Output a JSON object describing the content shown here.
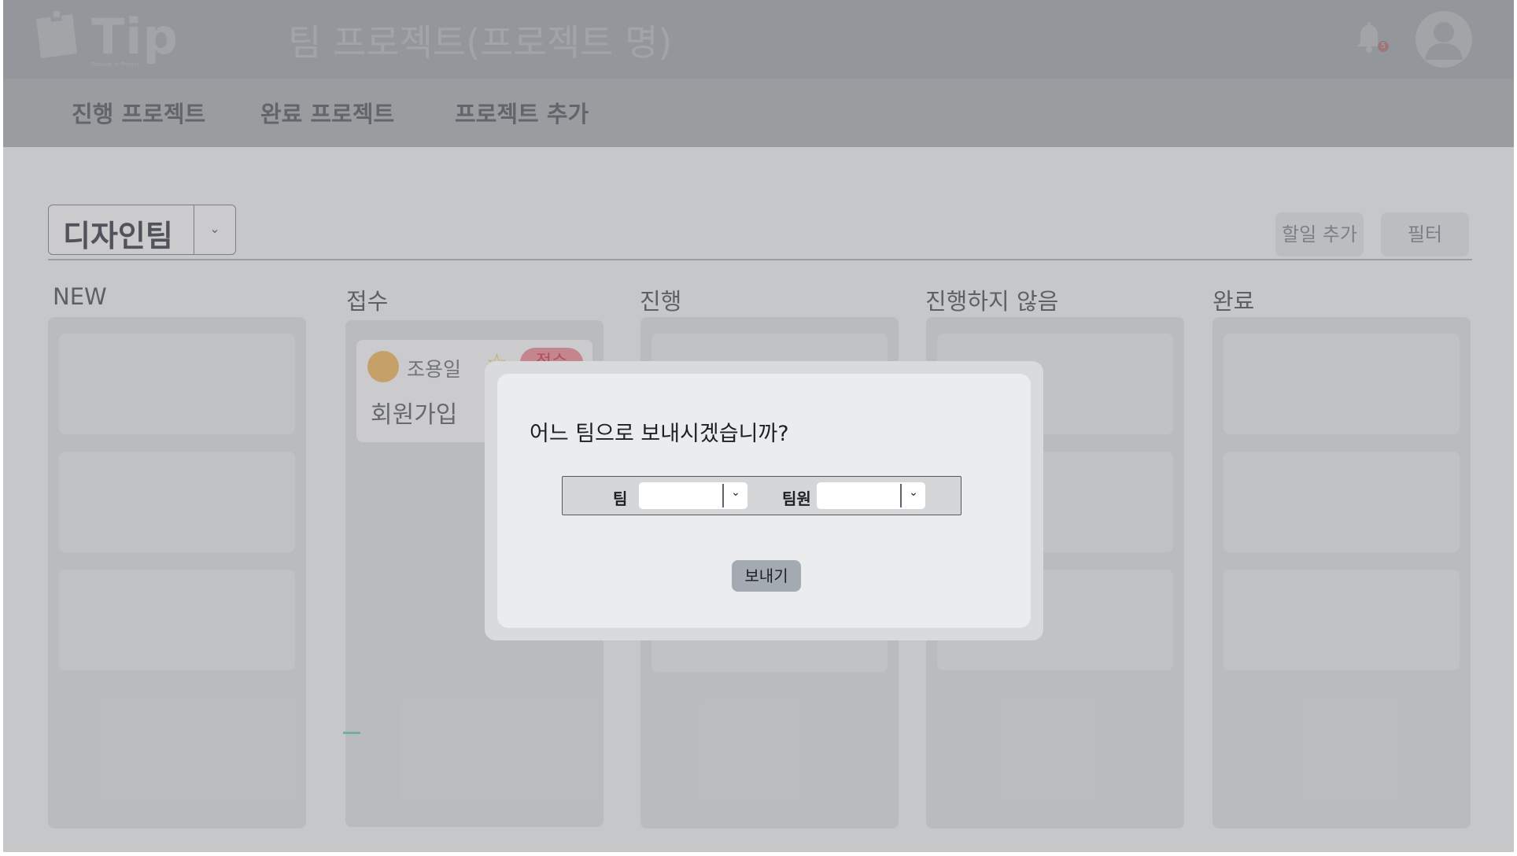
{
  "header": {
    "logo_text": "Tip",
    "logo_subtitle": "Todolist in Project",
    "project_title": "팀 프로젝트(프로젝트 명)",
    "notification_count": "5",
    "icons": {
      "bell": "bell-icon",
      "profile": "user-avatar-icon"
    }
  },
  "nav": {
    "items": [
      {
        "label": "진행 프로젝트"
      },
      {
        "label": "완료 프로젝트"
      },
      {
        "label": "프로젝트 추가"
      }
    ]
  },
  "board": {
    "team_select": {
      "value": "디자인팀",
      "icon": "chevron-down-icon"
    },
    "add_todo_label": "할일 추가",
    "filter_label": "필터",
    "columns": [
      {
        "title": "NEW"
      },
      {
        "title": "접수"
      },
      {
        "title": "진행"
      },
      {
        "title": "진행하지 않음"
      },
      {
        "title": "완료"
      }
    ],
    "task": {
      "user": "조용일",
      "status": "접수",
      "title": "회원가입",
      "icons": {
        "avatar": "tiger-avatar-icon",
        "favorite": "star-icon"
      }
    }
  },
  "modal": {
    "question": "어느 팀으로 보내시겠습니까?",
    "team_label": "팀",
    "team_value": "",
    "member_label": "팀원",
    "member_value": "",
    "send_label": "보내기"
  },
  "colors": {
    "header_bg": "#dfe3e8",
    "status_badge": "#f59aa3",
    "send_button": "#a4aab1",
    "overlay": "#5c5e62"
  }
}
